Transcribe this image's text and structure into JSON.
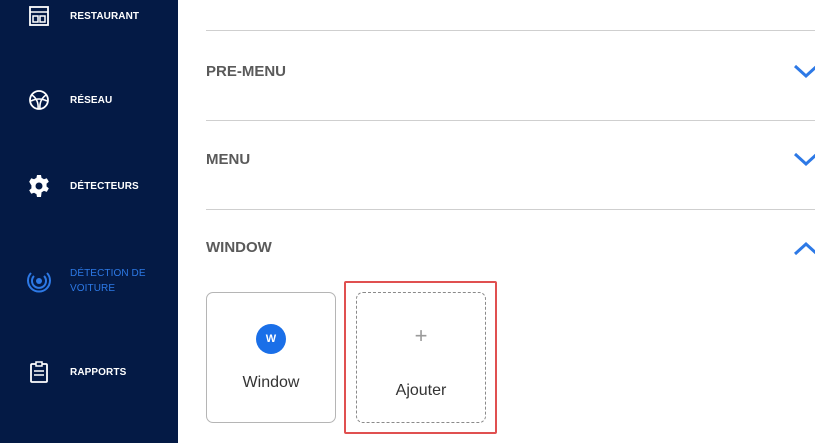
{
  "sidebar": {
    "items": [
      {
        "label": "RESTAURANT",
        "icon": "store-icon"
      },
      {
        "label": "RÉSEAU",
        "icon": "network-icon"
      },
      {
        "label": "DÉTECTEURS",
        "icon": "gear-icon"
      },
      {
        "label": "DÉTECTION DE VOITURE",
        "icon": "radar-icon",
        "active": true
      },
      {
        "label": "RAPPORTS",
        "icon": "clipboard-icon"
      }
    ]
  },
  "main": {
    "sections": [
      {
        "title": "PRE-MENU",
        "state": "collapsed"
      },
      {
        "title": "MENU",
        "state": "collapsed"
      },
      {
        "title": "WINDOW",
        "state": "expanded"
      }
    ],
    "window_cards": {
      "existing": {
        "badge": "W",
        "label": "Window"
      },
      "add": {
        "plus": "+",
        "label": "Ajouter"
      }
    }
  },
  "colors": {
    "sidebar_bg": "#041a45",
    "accent": "#2d79e6",
    "highlight": "#e05050"
  }
}
